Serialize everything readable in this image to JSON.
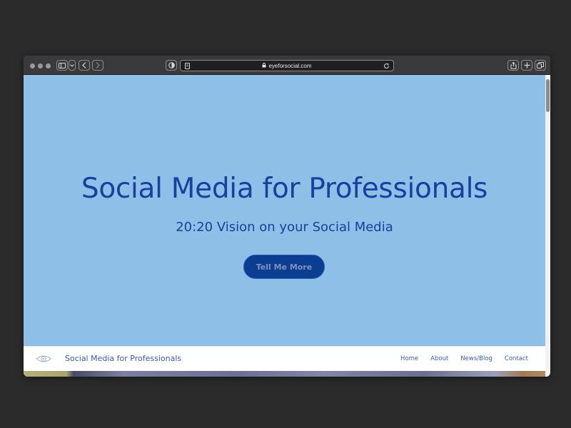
{
  "browser": {
    "url": "eyeforsocial.com",
    "icons": [
      "sidebar-icon",
      "chevron-down-icon",
      "back-icon",
      "forward-icon",
      "shield-icon",
      "reader-icon",
      "lock-icon",
      "reload-icon",
      "share-icon",
      "new-tab-icon",
      "tab-overview-icon"
    ]
  },
  "hero": {
    "title": "Social Media for Professionals",
    "subtitle": "20:20 Vision on your Social Media",
    "cta_label": "Tell Me More"
  },
  "navbar": {
    "brand": "Social Media for Professionals",
    "links": [
      "Home",
      "About",
      "News/Blog",
      "Contact"
    ]
  },
  "colors": {
    "hero_background": "#8ebfe6",
    "hero_text": "#1a3f9e",
    "cta_background": "#0b3d91",
    "nav_text": "#3c5aa6"
  }
}
